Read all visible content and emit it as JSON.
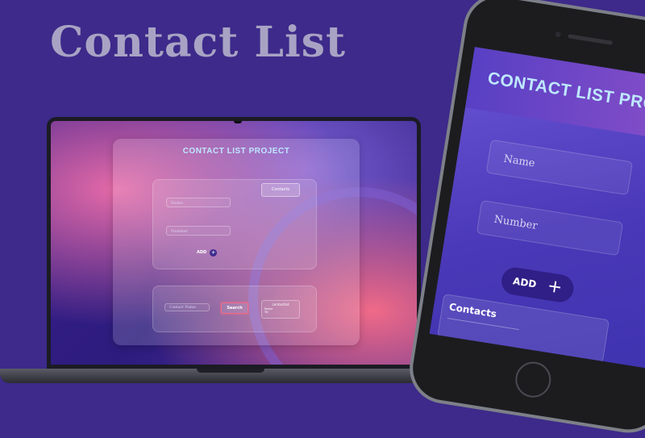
{
  "headline": "Contact List",
  "laptop": {
    "title": "CONTACT LIST PROJECT",
    "name_placeholder": "Name",
    "number_placeholder": "Number",
    "contacts_button": "Contacts",
    "add_label": "ADD",
    "add_icon": "+",
    "search_placeholder": "Contact Name",
    "search_button": "Search",
    "contact_box_heading": "contactlist",
    "contact_box_line1": "Name",
    "contact_box_line2": "Tel"
  },
  "phone": {
    "title": "CONTACT LIST PROJECT",
    "name_placeholder": "Name",
    "number_placeholder": "Number",
    "add_label": "ADD",
    "add_icon": "+",
    "contacts_label": "Contacts"
  },
  "colors": {
    "background": "#3d2a8a",
    "headline": "#a8a3c4",
    "title_accent": "#bfe8ff",
    "button_dark": "#2f1f86",
    "search_border": "#f06a88"
  }
}
